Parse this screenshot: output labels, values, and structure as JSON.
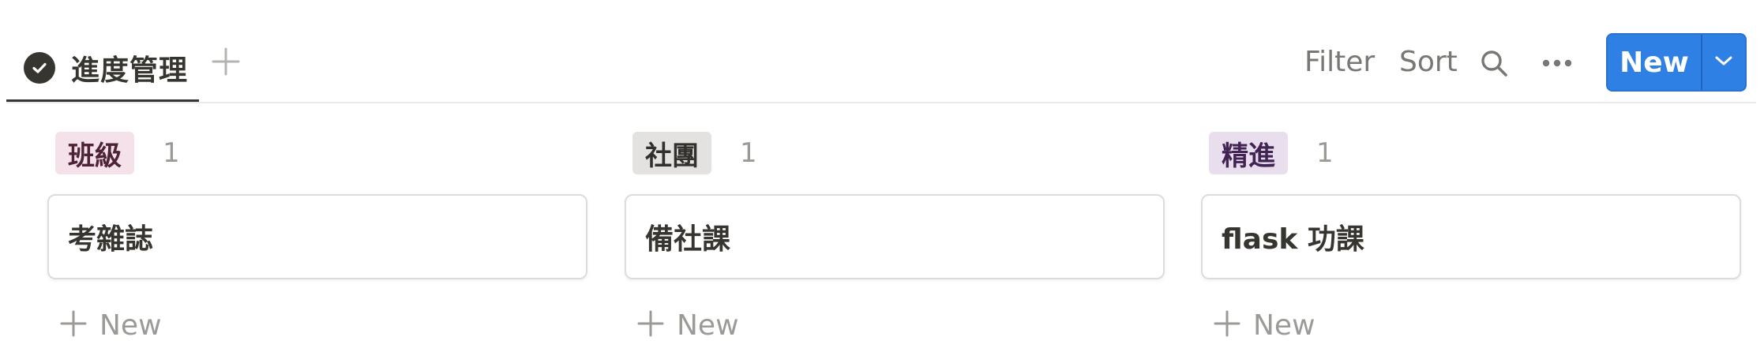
{
  "view": {
    "tab_label": "進度管理",
    "tab_icon": "check-circle-icon",
    "add_view_icon": "plus-icon"
  },
  "toolbar": {
    "filter_label": "Filter",
    "sort_label": "Sort",
    "search_icon": "search-icon",
    "more_icon": "more-horizontal-icon",
    "new_label": "New",
    "new_dropdown_icon": "chevron-down-icon",
    "accent_color": "#2f80e4"
  },
  "columns": [
    {
      "tag": "班級",
      "count": "1",
      "tag_bg": "#f4e1e9",
      "tag_fg": "#4c2337",
      "cards": [
        {
          "title": "考雜誌"
        }
      ],
      "new_label": "New"
    },
    {
      "tag": "社團",
      "count": "1",
      "tag_bg": "#e3e2e0",
      "tag_fg": "#32302c",
      "cards": [
        {
          "title": "備社課"
        }
      ],
      "new_label": "New"
    },
    {
      "tag": "精進",
      "count": "1",
      "tag_bg": "#e8deee",
      "tag_fg": "#412454",
      "cards": [
        {
          "title": "flask 功課"
        }
      ],
      "new_label": "New"
    }
  ]
}
